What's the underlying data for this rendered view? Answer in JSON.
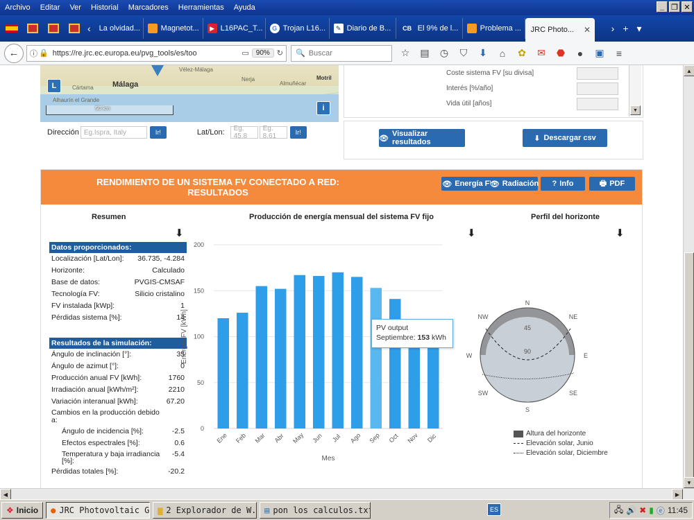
{
  "menubar": {
    "items": [
      "Archivo",
      "Editar",
      "Ver",
      "Historial",
      "Marcadores",
      "Herramientas",
      "Ayuda"
    ]
  },
  "tabs": [
    {
      "label": "La olvidad...",
      "icon": "page-icon"
    },
    {
      "label": "Magnetot...",
      "icon": "orange-square-icon"
    },
    {
      "label": "L16PAC_T...",
      "icon": "red-logo-icon"
    },
    {
      "label": "Trojan L16...",
      "icon": "google-icon"
    },
    {
      "label": "Diario de B...",
      "icon": "news-icon"
    },
    {
      "label": "El 9% de l...",
      "icon": "cb-icon"
    },
    {
      "label": "Problema ...",
      "icon": "orange-square-icon"
    },
    {
      "label": "JRC Photo...",
      "icon": "page-icon",
      "active": true
    }
  ],
  "navbar": {
    "url": "https://re.jrc.ec.europa.eu/pvg_tools/es/too",
    "zoom": "90%",
    "search_placeholder": "Buscar"
  },
  "map": {
    "city": "Málaga",
    "towns": [
      "Cártama",
      "Alhaurín el Grande",
      "Vélez-Málaga",
      "Nerja",
      "Almuñécar",
      "Motril"
    ],
    "scale_label": "50 km",
    "layer_button": "L",
    "info_button": "i"
  },
  "address": {
    "direccion_label": "Dirección",
    "direccion_placeholder": "Eg.Ispra, Italy",
    "latlon_label": "Lat/Lon:",
    "lat_placeholder": "Eg. 45.8",
    "lon_placeholder": "Eg. 8.61",
    "go_label": "Ir!"
  },
  "cost_panel": {
    "rows": [
      "Coste sistema FV [su divisa]",
      "Interés [%/año]",
      "Vida útil [años]"
    ]
  },
  "actions": {
    "visualize": "Visualizar resultados",
    "download_csv": "Descargar csv"
  },
  "results": {
    "title": "RENDIMIENTO DE UN SISTEMA FV CONECTADO A RED: RESULTADOS",
    "buttons": {
      "energy": "Energía FV",
      "radiation": "Radiación",
      "info": "Info",
      "pdf": "PDF"
    },
    "summary_title": "Resumen",
    "chart_title": "Producción de energía mensual del sistema FV fijo",
    "horizon_title": "Perfil del horizonte"
  },
  "summary": {
    "provided_header": "Datos proporcionados:",
    "provided": [
      {
        "label": "Localización [Lat/Lon]:",
        "value": "36.735, -4.284"
      },
      {
        "label": "Horizonte:",
        "value": "Calculado"
      },
      {
        "label": "Base de datos:",
        "value": "PVGIS-CMSAF"
      },
      {
        "label": "Tecnología FV:",
        "value": "Silicio cristalino"
      },
      {
        "label": "FV instalada [kWp]:",
        "value": "1"
      },
      {
        "label": "Pérdidas sistema [%]:",
        "value": "14"
      }
    ],
    "sim_header": "Resultados de la simulación:",
    "sim": [
      {
        "label": "Ángulo de inclinación [°]:",
        "value": "35"
      },
      {
        "label": "Ángulo de azimut [°]:",
        "value": "0"
      },
      {
        "label": "Producción anual FV [kWh]:",
        "value": "1760"
      },
      {
        "label": "Irradiación anual [kWh/m²]:",
        "value": "2210"
      },
      {
        "label": "Variación interanual [kWh]:",
        "value": "67.20"
      },
      {
        "label": "Cambios en la producción debido a:",
        "value": ""
      }
    ],
    "changes": [
      {
        "label": "Ángulo de incidencia [%]:",
        "value": "-2.5"
      },
      {
        "label": "Efectos espectrales [%]:",
        "value": "0.6"
      },
      {
        "label": "Temperatura y baja irradiancia [%]:",
        "value": "-5.4"
      }
    ],
    "total": {
      "label": "Pérdidas totales [%]:",
      "value": "-20.2"
    }
  },
  "chart_data": {
    "type": "bar",
    "categories": [
      "Ene",
      "Feb",
      "Mar",
      "Abr",
      "May",
      "Jun",
      "Jul",
      "Ago",
      "Sep",
      "Oct",
      "Nov",
      "Dic"
    ],
    "values": [
      120,
      126,
      155,
      152,
      167,
      166,
      170,
      165,
      153,
      141,
      119,
      110
    ],
    "xlabel": "Mes",
    "ylabel": "Energía FV [kWh]",
    "ylim": [
      0,
      200
    ],
    "yticks": [
      0,
      50,
      100,
      150,
      200
    ],
    "grid": true,
    "bar_color": "#2f9ee8",
    "highlight_color": "#5ab8f0",
    "highlight_index": 8,
    "tooltip": {
      "series": "PV output",
      "category": "Septiembre",
      "value": "153",
      "unit": "kWh"
    }
  },
  "horizon": {
    "compass": [
      "N",
      "NE",
      "E",
      "SE",
      "S",
      "SW",
      "W",
      "NW"
    ],
    "rings": [
      "45",
      "90"
    ],
    "legend": [
      "Altura del horizonte",
      "Elevación solar, Junio",
      "Elevación solar, Diciembre"
    ]
  },
  "taskbar": {
    "start": "Inicio",
    "tasks": [
      "JRC Photovoltaic G...",
      "2 Explorador de W...",
      "pon los calculos.txt ..."
    ],
    "lang": "ES",
    "clock": "11:45"
  }
}
